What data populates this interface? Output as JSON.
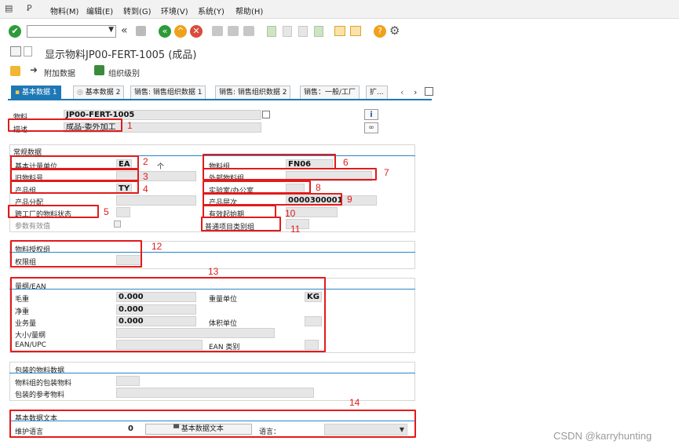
{
  "menu": {
    "items": [
      "物料(M)",
      "编辑(E)",
      "转到(G)",
      "环境(V)",
      "系统(Y)",
      "帮助(H)"
    ]
  },
  "title": "显示物料JP00-FERT-1005 (成品)",
  "app_toolbar": {
    "additional_data": "附加数据",
    "org_levels": "组织级别"
  },
  "tabs": [
    "基本数据 1",
    "基本数据 2",
    "销售: 销售组织数据 1",
    "销售: 销售组织数据 2",
    "销售：一般/工厂",
    "扩..."
  ],
  "header": {
    "material_label": "物料",
    "material_value": "JP00-FERT-1005",
    "desc_label": "描述",
    "desc_value": "成品-委外加工"
  },
  "general": {
    "title": "常规数据",
    "base_uom_label": "基本计量单位",
    "base_uom_value": "EA",
    "base_uom_text": "个",
    "old_material_label": "旧物料号",
    "division_label": "产品组",
    "division_value": "TY",
    "alloc_label": "产品分配",
    "xplant_status_label": "跨工厂的物料状态",
    "valid_label": "参数有效值",
    "matl_group_label": "物料组",
    "matl_group_value": "FN06",
    "ext_matl_group_label": "外部物料组",
    "lab_office_label": "实验室/办公室",
    "prod_hier_label": "产品层次",
    "prod_hier_value": "0000300001",
    "valid_from_label": "有效起始期",
    "gen_item_cat_label": "普通项目类别组"
  },
  "auth": {
    "title": "物料授权组",
    "auth_group_label": "权限组"
  },
  "dims": {
    "title": "量纲/EAN",
    "gross_label": "毛重",
    "gross_value": "0.000",
    "net_label": "净重",
    "net_value": "0.000",
    "volume_label": "业务量",
    "volume_value": "0.000",
    "size_label": "大小/量纲",
    "ean_label": "EAN/UPC",
    "weight_unit_label": "重量单位",
    "weight_unit_value": "KG",
    "volume_unit_label": "体积单位",
    "ean_cat_label": "EAN 类别"
  },
  "packaging": {
    "title": "包装的物料数据",
    "matl_grp_pack_label": "物料组的包装物料",
    "ref_mat_label": "包装的参考物料"
  },
  "basic_text": {
    "title": "基本数据文本",
    "lang_label": "维护语言",
    "lang_value": "0",
    "text_button": "基本数据文本",
    "language_label": "语言："
  },
  "annotations": [
    "1",
    "2",
    "3",
    "4",
    "5",
    "6",
    "7",
    "8",
    "9",
    "10",
    "11",
    "12",
    "13",
    "14"
  ],
  "watermark": "CSDN @karryhunting",
  "colors": {
    "accent": "#1f78b6",
    "highlight": "#e21b1b"
  }
}
